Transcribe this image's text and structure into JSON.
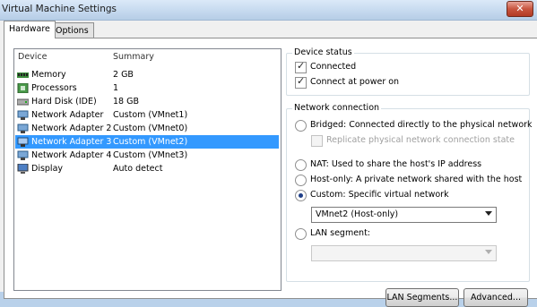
{
  "window": {
    "title": "Virtual Machine Settings",
    "close_glyph": "✕"
  },
  "tabs": [
    {
      "label": "Hardware",
      "active": true
    },
    {
      "label": "Options",
      "active": false
    }
  ],
  "device_list": {
    "headers": {
      "device": "Device",
      "summary": "Summary"
    },
    "rows": [
      {
        "device": "Memory",
        "summary": "2 GB",
        "icon": "memory-icon"
      },
      {
        "device": "Processors",
        "summary": "1",
        "icon": "processor-icon"
      },
      {
        "device": "Hard Disk (IDE)",
        "summary": "18 GB",
        "icon": "hard-disk-icon"
      },
      {
        "device": "Network Adapter",
        "summary": "Custom (VMnet1)",
        "icon": "network-adapter-icon"
      },
      {
        "device": "Network Adapter 2",
        "summary": "Custom (VMnet0)",
        "icon": "network-adapter-icon"
      },
      {
        "device": "Network Adapter 3",
        "summary": "Custom (VMnet2)",
        "icon": "network-adapter-icon",
        "selected": true
      },
      {
        "device": "Network Adapter 4",
        "summary": "Custom (VMnet3)",
        "icon": "network-adapter-icon"
      },
      {
        "device": "Display",
        "summary": "Auto detect",
        "icon": "display-icon"
      }
    ]
  },
  "device_status": {
    "title": "Device status",
    "connected": {
      "label": "Connected",
      "checked": true
    },
    "connect_at_power_on": {
      "label": "Connect at power on",
      "checked": true
    }
  },
  "network_connection": {
    "title": "Network connection",
    "bridged": {
      "label": "Bridged: Connected directly to the physical network",
      "checked": false
    },
    "replicate": {
      "label": "Replicate physical network connection state",
      "checked": false,
      "disabled": true
    },
    "nat": {
      "label": "NAT: Used to share the host's IP address",
      "checked": false
    },
    "host_only": {
      "label": "Host-only: A private network shared with the host",
      "checked": false
    },
    "custom": {
      "label": "Custom: Specific virtual network",
      "checked": true
    },
    "custom_select_value": "VMnet2 (Host-only)",
    "lan_segment": {
      "label": "LAN segment:",
      "checked": false
    },
    "lan_segment_select_value": ""
  },
  "buttons": {
    "lan_segments": "LAN Segments...",
    "advanced": "Advanced..."
  },
  "colors": {
    "selection": "#3399ff",
    "title_bar": "#c4d8ee",
    "close": "#c8553f"
  }
}
